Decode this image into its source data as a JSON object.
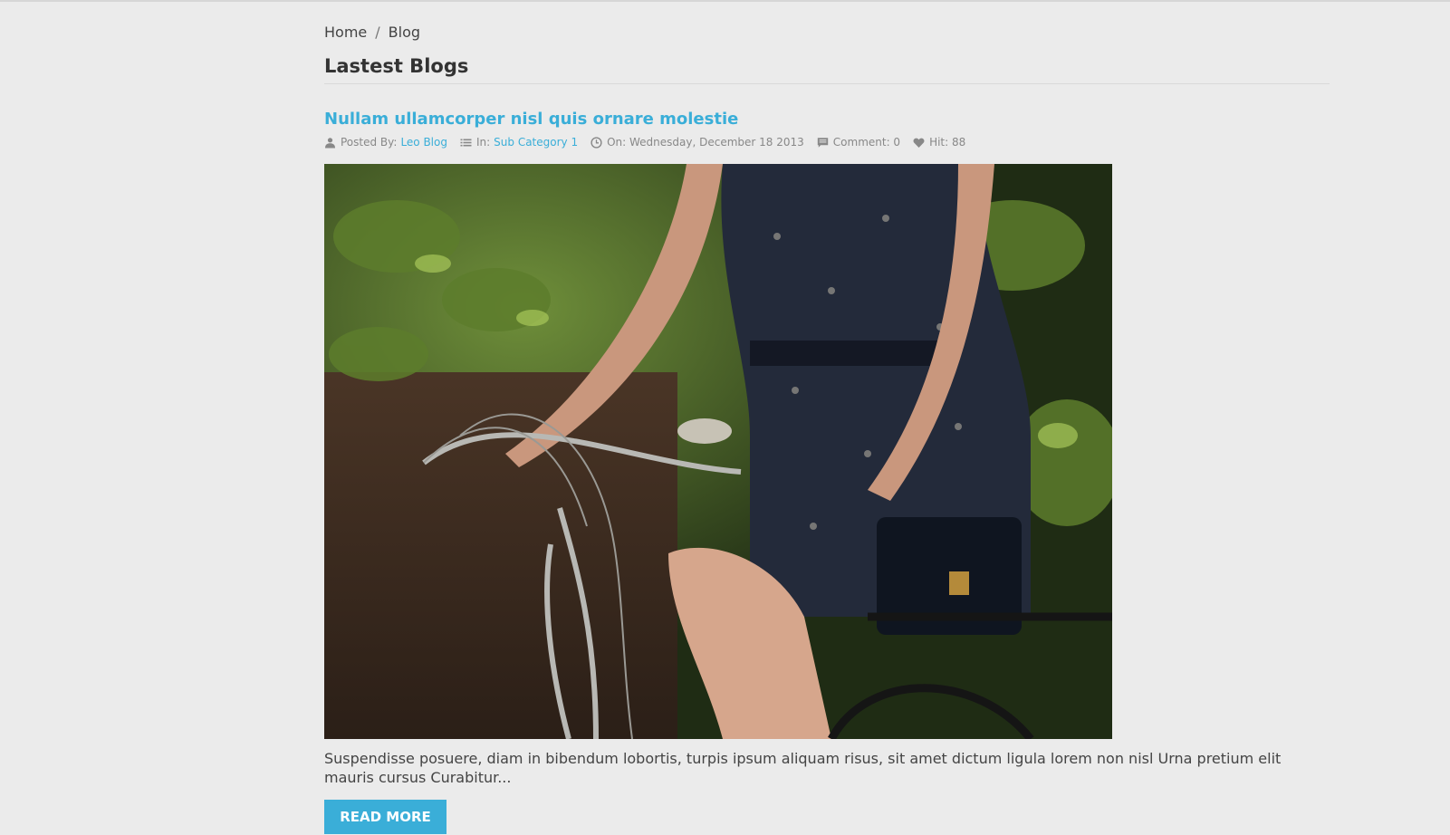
{
  "breadcrumb": {
    "home": "Home",
    "separator": "/",
    "current": "Blog"
  },
  "page": {
    "title": "Lastest Blogs"
  },
  "post": {
    "title": "Nullam ullamcorper nisl quis ornare molestie",
    "meta": {
      "posted_by_label": "Posted By:",
      "author": "Leo Blog",
      "in_label": "In:",
      "category": "Sub Category 1",
      "date": "On: Wednesday, December 18 2013",
      "comments": "Comment: 0",
      "hits": "Hit: 88",
      "icons": [
        "user-icon",
        "list-icon",
        "clock-icon",
        "comment-icon",
        "heart-icon"
      ]
    },
    "image_alt": "Woman in floral dress riding a bicycle",
    "excerpt": "Suspendisse posuere, diam in bibendum lobortis, turpis ipsum aliquam risus, sit amet dictum ligula lorem non nisl Urna pretium elit mauris cursus Curabitur...",
    "read_more": "READ MORE"
  },
  "colors": {
    "accent": "#3aaed8",
    "background": "#ebebeb",
    "text": "#333333",
    "meta": "#888888"
  }
}
